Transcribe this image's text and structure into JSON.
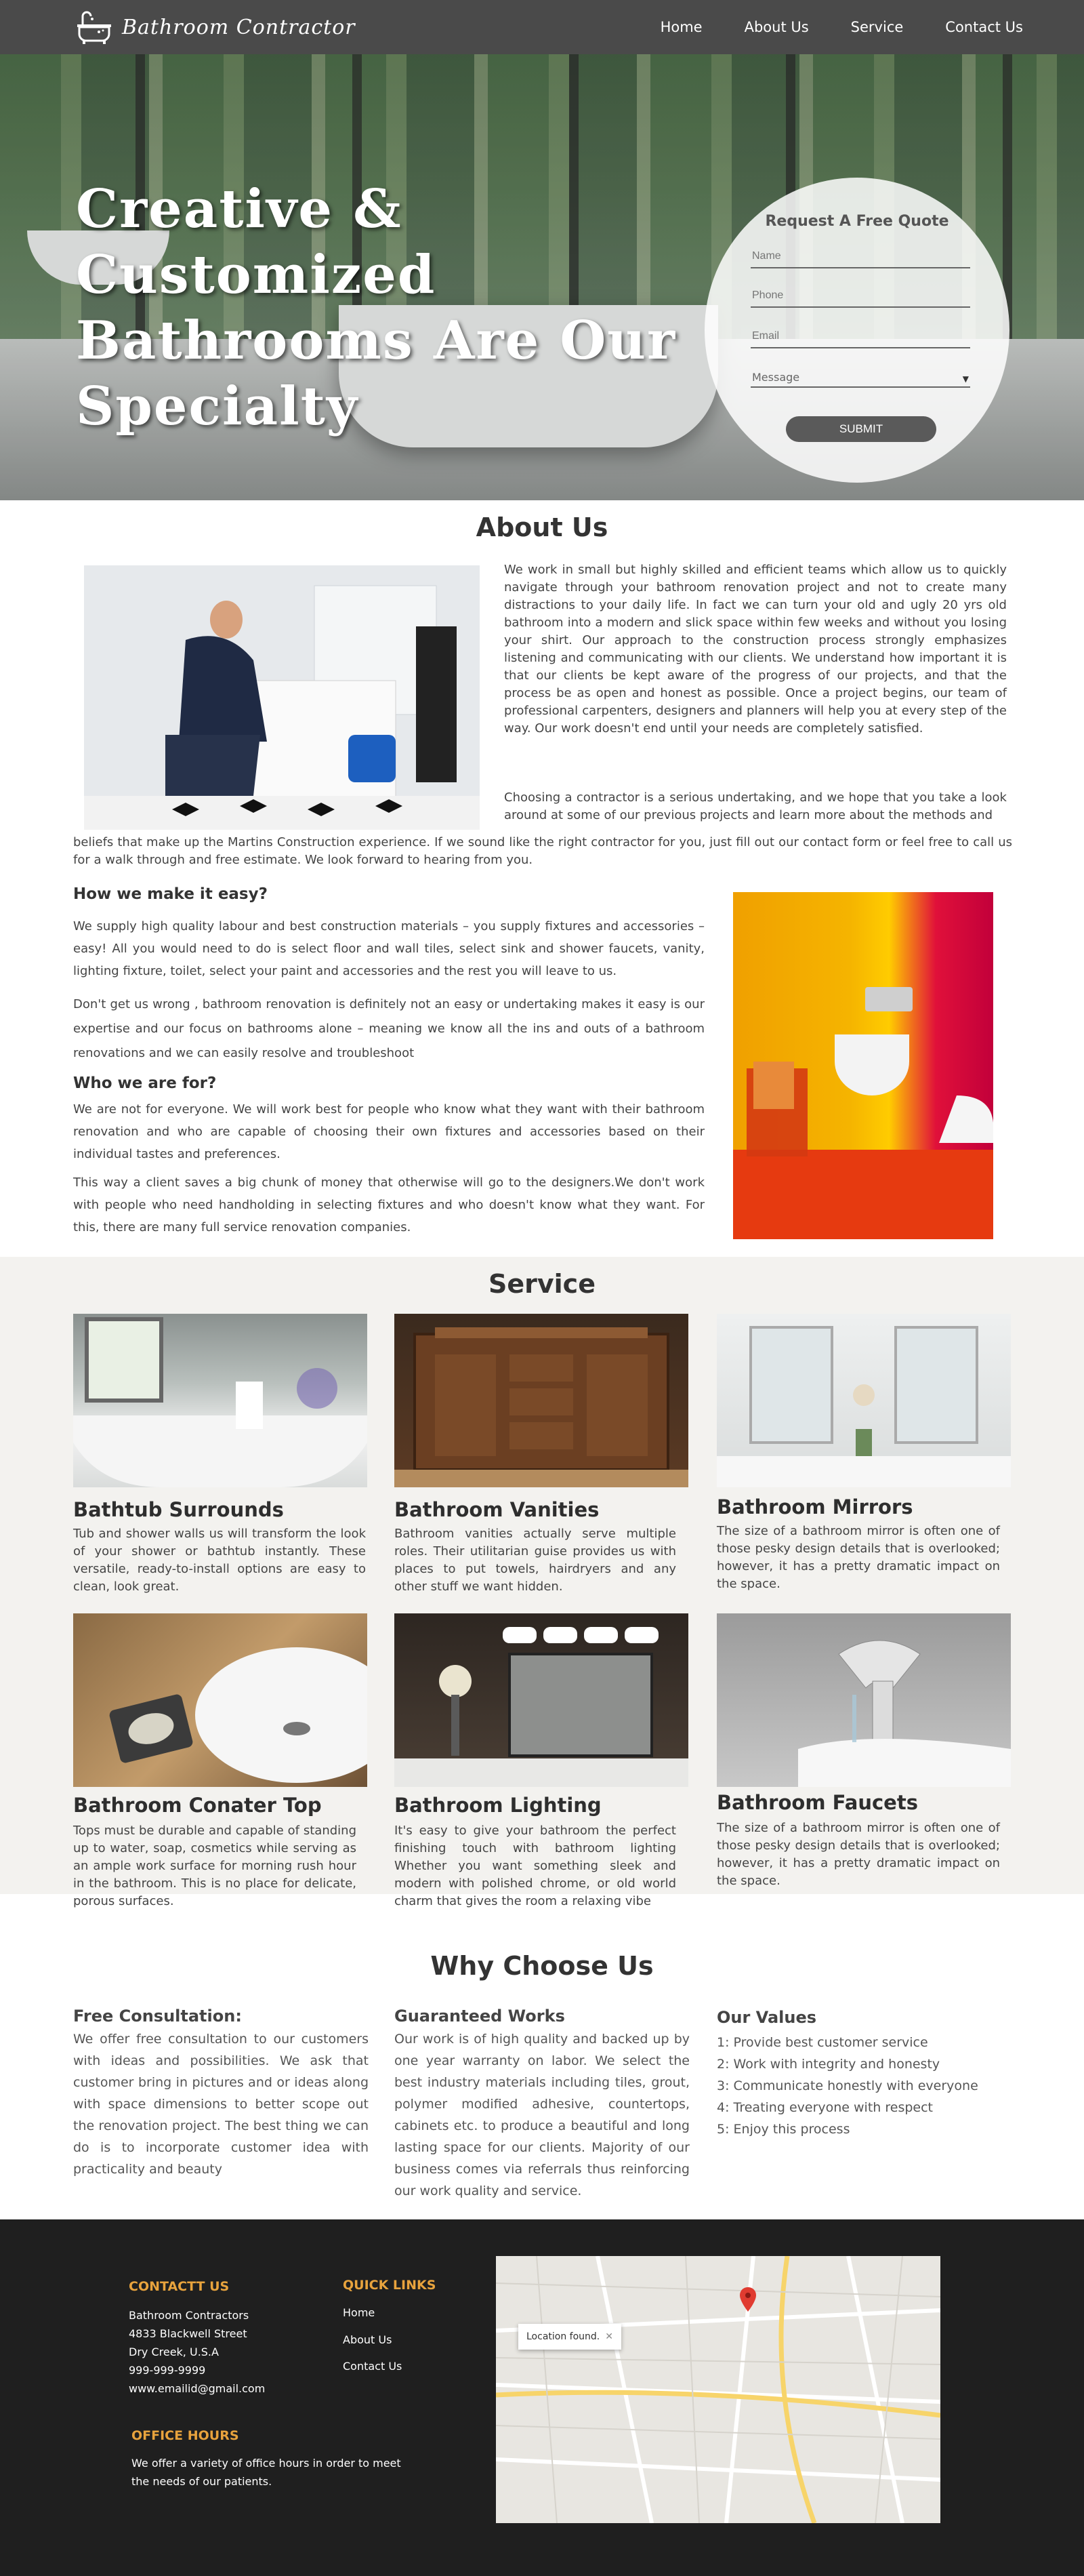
{
  "nav": {
    "brand": "Bathroom Contractor",
    "links": [
      "Home",
      "About Us",
      "Service",
      "Contact Us"
    ]
  },
  "hero": {
    "title": "Creative & Customized Bathrooms Are Our Specialty"
  },
  "quote_form": {
    "title": "Request A Free Quote",
    "name_placeholder": "Name",
    "phone_placeholder": "Phone",
    "email_placeholder": "Email",
    "message_placeholder": "Message",
    "submit_label": "SUBMIT"
  },
  "about": {
    "title": "About Us",
    "p1": "We work in small but highly skilled and efficient teams which allow us to quickly navigate through your bathroom renovation project and not to create many distractions to your daily life. In fact we can turn your old and ugly 20 yrs old bathroom into a modern and slick space within few weeks and without you losing your shirt. Our approach to the construction process strongly emphasizes listening and communicating with our clients. We understand how important it is that our clients be kept aware of the progress of our projects, and that the process be as open and honest as possible. Once a project begins, our team of professional carpenters, designers and planners will help you at every step of the way. Our work doesn't end until your needs are completely satisfied.",
    "p2_part1": "Choosing a contractor is a serious undertaking, and we hope that you take a look around at some of our previous projects and learn more about the methods and",
    "p2_part2": "beliefs that make up the Martins Construction experience. If we sound like the right contractor for you, just fill out our contact form or feel free to call us for a walk through and free estimate. We look forward to hearing from you."
  },
  "how": {
    "title": "How we make it easy?",
    "p1": "We supply high quality labour and best construction materials – you supply fixtures and accessories – easy! All you would need to do is select floor and wall tiles, select sink and shower faucets, vanity, lighting fixture, toilet, select your paint and accessories and the rest you will leave to us.",
    "p2": "Don't get us wrong , bathroom renovation is definitely not an easy or undertaking  makes it easy is our expertise and our focus on bathrooms alone – meaning we know all the ins and outs of a bathroom renovations and we can easily resolve and troubleshoot"
  },
  "who": {
    "title": "Who we are for?",
    "p1": "We are not for everyone. We will work best for people who know what they want with their bathroom renovation and who are capable of choosing their own fixtures and accessories based on their individual tastes and preferences.",
    "p2": "This way a client saves a big chunk of money that otherwise will go to the designers.We don't work with people who need handholding in selecting fixtures and who doesn't know what they want. For this, there are many full service renovation companies."
  },
  "service": {
    "title": "Service",
    "items": [
      {
        "title": "Bathtub Surrounds",
        "text": "Tub and shower walls us will transform the look of your shower or bathtub instantly. These versatile, ready-to-install options are easy to clean, look great."
      },
      {
        "title": "Bathroom Vanities",
        "text": "Bathroom vanities actually serve multiple roles. Their utilitarian guise provides us with places to put towels, hairdryers and any other stuff we want hidden."
      },
      {
        "title": "Bathroom Mirrors",
        "text": "The size of a bathroom mirror is often one of those pesky design details that is overlooked; however, it has a pretty dramatic impact on the space."
      },
      {
        "title": "Bathroom Conater Top",
        "text": "Tops must be durable and capable of standing up to water, soap, cosmetics while serving as an ample work surface for morning rush hour in the bathroom. This is no place for delicate, porous surfaces."
      },
      {
        "title": "Bathroom Lighting",
        "text": "It's easy to give your bathroom the perfect finishing touch with bathroom lighting Whether you want something sleek and modern with polished chrome, or old world charm that gives the room a relaxing vibe"
      },
      {
        "title": "Bathroom Faucets",
        "text": "The size of a bathroom mirror is often one of those pesky design details that is overlooked; however, it has a pretty dramatic impact on the space."
      }
    ]
  },
  "why": {
    "title": "Why Choose Us",
    "free_title": "Free Consultation:",
    "free_text": "We offer free consultation to our customers with ideas and possibilities. We ask that customer bring in pictures and or ideas along with space dimensions to better scope out the renovation project. The best thing we can do is to incorporate customer idea with practicality and beauty",
    "works_title": "Guaranteed Works",
    "works_text": "Our work is of high quality and backed up by one year warranty on labor. We select the best industry materials including tiles, grout, polymer modified adhesive, countertops, cabinets etc. to produce a beautiful and long lasting space for our clients. Majority of our business comes via referrals thus reinforcing our work quality and service.",
    "values_title": "Our Values",
    "values": [
      "1: Provide best customer service",
      "2: Work with integrity and honesty",
      "3: Communicate honestly with everyone",
      "4: Treating everyone with respect",
      "5: Enjoy this process"
    ]
  },
  "footer": {
    "contact_title": "CONTACTT US",
    "contact_lines": [
      "Bathroom Contractors",
      "4833  Blackwell Street",
      "Dry Creek, U.S.A",
      "999-999-9999",
      "www.emailid@gmail.com"
    ],
    "links_title": "QUICK LINKS",
    "links": [
      "Home",
      "About Us",
      "Contact Us"
    ],
    "hours_title": "OFFICE HOURS",
    "hours_text": "We offer a variety of office hours in order to meet the needs of our patients.",
    "map_tooltip": "Location found."
  },
  "colors": {
    "nav_bg": "#4a4a4a",
    "footer_bg": "#1f1f1f",
    "footer_accent": "#e8a33d",
    "service_bg": "#f3f2ef"
  }
}
